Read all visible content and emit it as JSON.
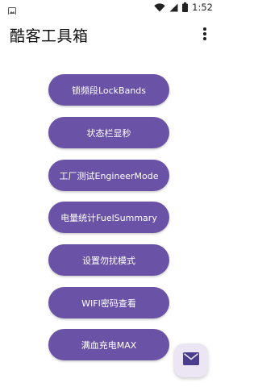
{
  "status_bar": {
    "time": "1:52",
    "icons": [
      "image-notification-icon",
      "wifi-icon",
      "signal-icon",
      "battery-icon"
    ]
  },
  "app_bar": {
    "title": "酷客工具箱",
    "menu_icon": "overflow-menu-icon"
  },
  "tools": [
    {
      "id": "lockbands",
      "label": "锁频段LockBands"
    },
    {
      "id": "status-seconds",
      "label": "状态栏显秒"
    },
    {
      "id": "engineer-mode",
      "label": "工厂测试EngineerMode"
    },
    {
      "id": "fuel-summary",
      "label": "电量统计FuelSummary"
    },
    {
      "id": "dnd-mode",
      "label": "设置勿扰模式"
    },
    {
      "id": "wifi-password",
      "label": "WIFI密码查看"
    },
    {
      "id": "charge-max",
      "label": "满血充电MAX"
    }
  ],
  "fab": {
    "icon": "mail-icon"
  },
  "colors": {
    "button": "#6a53a6",
    "fab_bg": "#ece6f4",
    "fab_icon": "#4a3d8f"
  }
}
